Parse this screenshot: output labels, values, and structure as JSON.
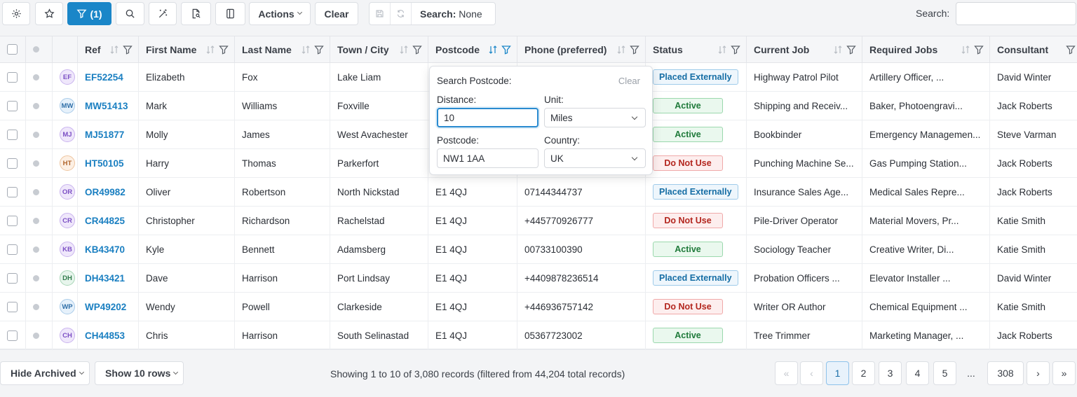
{
  "toolbar": {
    "filter_label": "(1)",
    "actions_label": "Actions",
    "clear_label": "Clear",
    "search_state_label": "Search:",
    "search_state_value": "None",
    "search_label": "Search:",
    "search_value": ""
  },
  "columns": [
    "Ref",
    "First Name",
    "Last Name",
    "Town / City",
    "Postcode",
    "Phone (preferred)",
    "Status",
    "Current Job",
    "Required Jobs",
    "Consultant"
  ],
  "rows": [
    {
      "initials": "EF",
      "ref": "EF52254",
      "first": "Elizabeth",
      "last": "Fox",
      "town": "Lake Liam",
      "postcode": "",
      "phone": "",
      "status": "Placed Externally",
      "current_job": "Highway Patrol Pilot",
      "required_jobs": "Artillery Officer, ...",
      "consultant": "David Winter"
    },
    {
      "initials": "MW",
      "ref": "MW51413",
      "first": "Mark",
      "last": "Williams",
      "town": "Foxville",
      "postcode": "",
      "phone": "",
      "status": "Active",
      "current_job": "Shipping and Receiv...",
      "required_jobs": "Baker, Photoengravi...",
      "consultant": "Jack Roberts"
    },
    {
      "initials": "MJ",
      "ref": "MJ51877",
      "first": "Molly",
      "last": "James",
      "town": "West Avachester",
      "postcode": "",
      "phone": "",
      "status": "Active",
      "current_job": "Bookbinder",
      "required_jobs": "Emergency Managemen...",
      "consultant": "Steve Varman"
    },
    {
      "initials": "HT",
      "ref": "HT50105",
      "first": "Harry",
      "last": "Thomas",
      "town": "Parkerfort",
      "postcode": "",
      "phone": "",
      "status": "Do Not Use",
      "current_job": "Punching Machine Se...",
      "required_jobs": "Gas Pumping Station...",
      "consultant": "Jack Roberts"
    },
    {
      "initials": "OR",
      "ref": "OR49982",
      "first": "Oliver",
      "last": "Robertson",
      "town": "North Nickstad",
      "postcode": "E1 4QJ",
      "phone": "07144344737",
      "status": "Placed Externally",
      "current_job": "Insurance Sales Age...",
      "required_jobs": "Medical Sales Repre...",
      "consultant": "Jack Roberts"
    },
    {
      "initials": "CR",
      "ref": "CR44825",
      "first": "Christopher",
      "last": "Richardson",
      "town": "Rachelstad",
      "postcode": "E1 4QJ",
      "phone": "+445770926777",
      "status": "Do Not Use",
      "current_job": "Pile-Driver Operator",
      "required_jobs": "Material Movers, Pr...",
      "consultant": "Katie Smith"
    },
    {
      "initials": "KB",
      "ref": "KB43470",
      "first": "Kyle",
      "last": "Bennett",
      "town": "Adamsberg",
      "postcode": "E1 4QJ",
      "phone": "00733100390",
      "status": "Active",
      "current_job": "Sociology Teacher",
      "required_jobs": "Creative Writer, Di...",
      "consultant": "Katie Smith"
    },
    {
      "initials": "DH",
      "ref": "DH43421",
      "first": "Dave",
      "last": "Harrison",
      "town": "Port Lindsay",
      "postcode": "E1 4QJ",
      "phone": "+4409878236514",
      "status": "Placed Externally",
      "current_job": "Probation Officers ...",
      "required_jobs": "Elevator Installer ...",
      "consultant": "David Winter"
    },
    {
      "initials": "WP",
      "ref": "WP49202",
      "first": "Wendy",
      "last": "Powell",
      "town": "Clarkeside",
      "postcode": "E1 4QJ",
      "phone": "+446936757142",
      "status": "Do Not Use",
      "current_job": "Writer OR Author",
      "required_jobs": "Chemical Equipment ...",
      "consultant": "Katie Smith"
    },
    {
      "initials": "CH",
      "ref": "CH44853",
      "first": "Chris",
      "last": "Harrison",
      "town": "South Selinastad",
      "postcode": "E1 4QJ",
      "phone": "05367723002",
      "status": "Active",
      "current_job": "Tree Trimmer",
      "required_jobs": "Marketing Manager, ...",
      "consultant": "Jack Roberts"
    }
  ],
  "popover": {
    "title": "Search Postcode:",
    "clear": "Clear",
    "distance_label": "Distance:",
    "distance_value": "10",
    "unit_label": "Unit:",
    "unit_value": "Miles",
    "postcode_label": "Postcode:",
    "postcode_value": "NW1 1AA",
    "country_label": "Country:",
    "country_value": "UK"
  },
  "footer": {
    "archived_label": "Hide Archived",
    "rows_label": "Show 10 rows",
    "info": "Showing 1 to 10 of 3,080 records (filtered from 44,204 total records)",
    "pages": [
      "1",
      "2",
      "3",
      "4",
      "5",
      "...",
      "308"
    ],
    "first": "«",
    "prev": "‹",
    "next": "›",
    "last": "»"
  },
  "colors": {
    "accent": "#1a86c8",
    "placed": "#166ea5",
    "active": "#1f7a3a",
    "do_not_use": "#b3261e"
  }
}
